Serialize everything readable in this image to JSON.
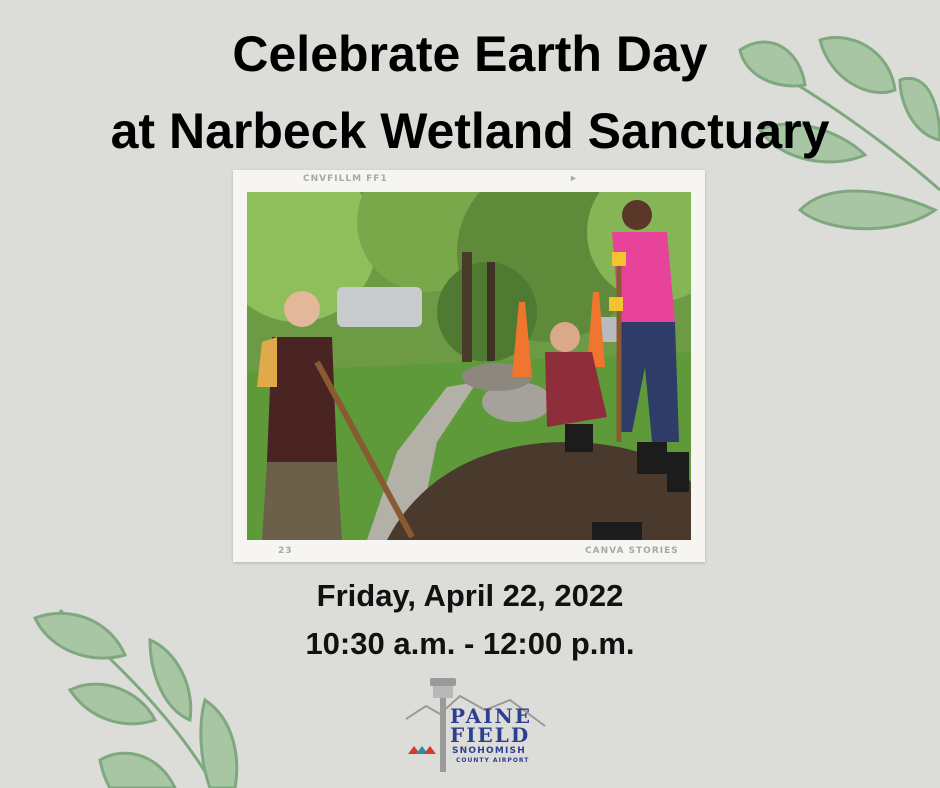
{
  "title": {
    "line1": "Celebrate Earth  Day",
    "line2": "at Narbeck Wetland Sanctuary"
  },
  "photo": {
    "film_top_label": "CNVFILLM FF1",
    "film_bottom_left": "23",
    "film_bottom_right": "CANVA STORIES"
  },
  "event": {
    "date": "Friday, April 22, 2022",
    "time": "10:30 a.m. - 12:00 p.m."
  },
  "logo": {
    "line1": "PAINE",
    "line2": "FIELD",
    "line3": "SNOHOMISH",
    "line4": "COUNTY AIRPORT"
  },
  "colors": {
    "background": "#dcddd8",
    "leaf_fill": "#a9c6a4",
    "leaf_stroke": "#7fa880",
    "logo_blue": "#2f3f8f"
  }
}
